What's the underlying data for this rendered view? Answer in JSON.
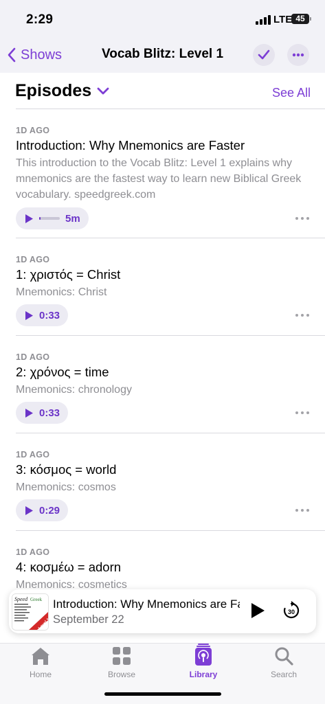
{
  "status_bar": {
    "time": "2:29",
    "network": "LTE",
    "battery": "45"
  },
  "nav": {
    "back_label": "Shows",
    "title": "Vocab Blitz: Level 1"
  },
  "section": {
    "title": "Episodes",
    "see_all": "See All"
  },
  "episodes": [
    {
      "date": "1D AGO",
      "title": "Introduction: Why Mnemonics are Faster",
      "description": "This introduction to the Vocab Blitz: Level 1 explains why mnemonics are the fastest way to learn new Biblical Greek vocabulary.  speedgreek.com",
      "duration": "5m",
      "played_fraction": 0.05
    },
    {
      "date": "1D AGO",
      "title": "1: χριστός = Christ",
      "description": "Mnemonics: Christ",
      "duration": "0:33"
    },
    {
      "date": "1D AGO",
      "title": "2: χρόνος = time",
      "description": "Mnemonics: chronology",
      "duration": "0:33"
    },
    {
      "date": "1D AGO",
      "title": "3: κόσμος = world",
      "description": "Mnemonics: cosmos",
      "duration": "0:29"
    },
    {
      "date": "1D AGO",
      "title": "4: κοσμέω = adorn",
      "description": "Mnemonics: cosmetics"
    }
  ],
  "mini_player": {
    "title": "Introduction: Why Mnemonics are Faster",
    "subtitle": "September 22",
    "artwork_text": "Speed Greek",
    "artwork_badge": "Level 1"
  },
  "tabs": [
    {
      "label": "Home",
      "icon": "home-icon",
      "active": false
    },
    {
      "label": "Browse",
      "icon": "grid-icon",
      "active": false
    },
    {
      "label": "Library",
      "icon": "library-icon",
      "active": true
    },
    {
      "label": "Search",
      "icon": "search-icon",
      "active": false
    }
  ],
  "colors": {
    "accent": "#7d3ed5",
    "secondary_text": "#8e8e93",
    "background": "#f2f2f7"
  }
}
